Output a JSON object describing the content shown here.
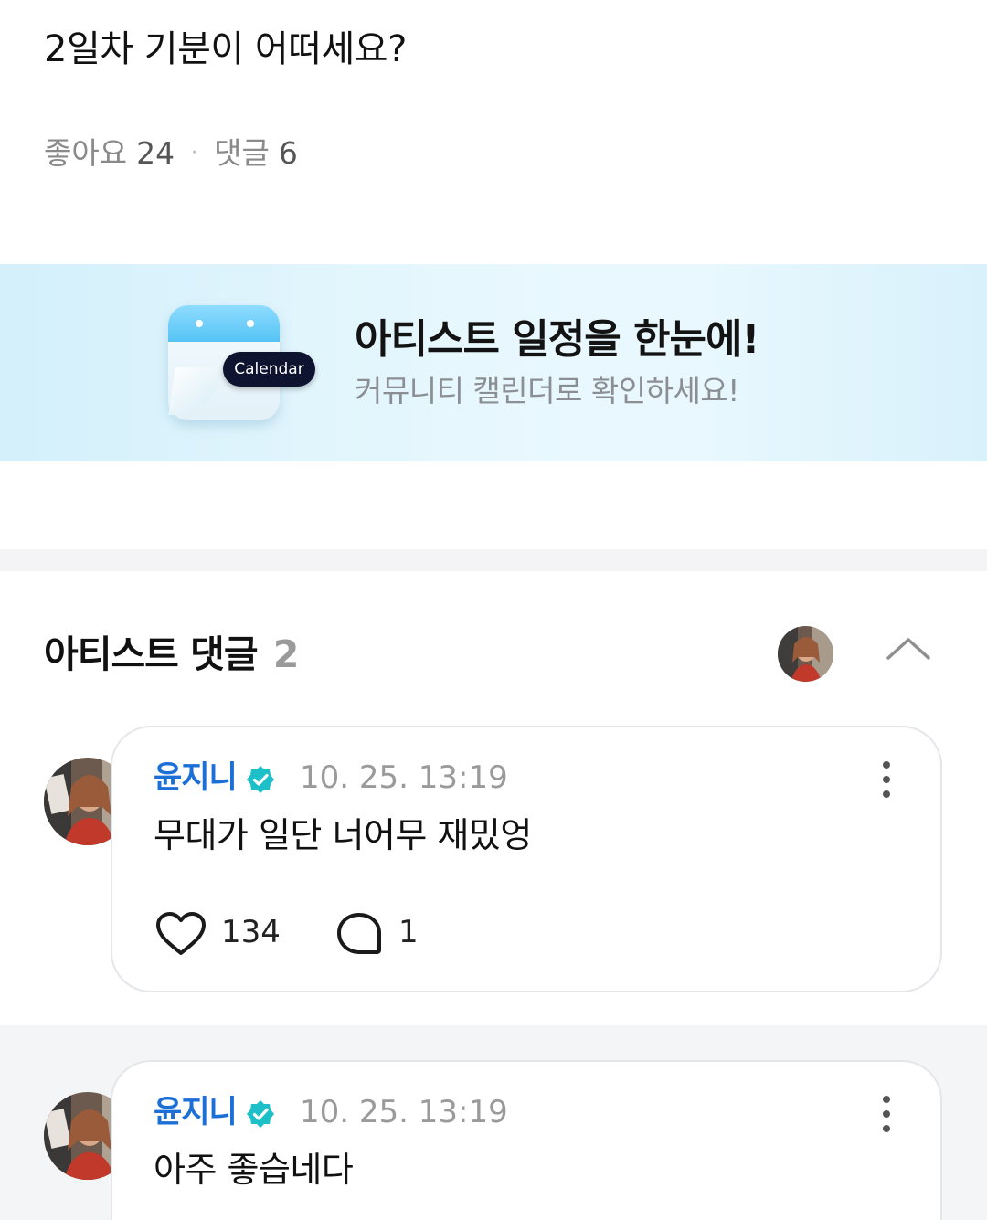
{
  "post": {
    "title": "2일차 기분이 어떠세요?",
    "likes_label": "좋아요",
    "likes_count": "24",
    "separator": "·",
    "comments_label": "댓글",
    "comments_count": "6"
  },
  "banner": {
    "calendar_label": "Calendar",
    "headline": "아티스트 일정을 한눈에!",
    "subline": "커뮤니티 캘린더로 확인하세요!"
  },
  "artist_comments": {
    "title": "아티스트 댓글",
    "count": "2",
    "items": [
      {
        "author": "윤지니",
        "timestamp": "10. 25. 13:19",
        "text": "무대가 일단 너어무 재밌엉",
        "likes": "134",
        "replies": "1"
      },
      {
        "author": "윤지니",
        "timestamp": "10. 25. 13:19",
        "text": "아주 좋습네다"
      }
    ]
  },
  "colors": {
    "author_blue": "#1b6fd6",
    "verified_teal": "#1dc0c8",
    "meta_gray": "#8a8a8a",
    "banner_bg": "#e3f6fd"
  },
  "icons": [
    "calendar-icon",
    "verified-icon",
    "more-vertical-icon",
    "heart-icon",
    "comment-bubble-icon",
    "chevron-up-icon"
  ]
}
